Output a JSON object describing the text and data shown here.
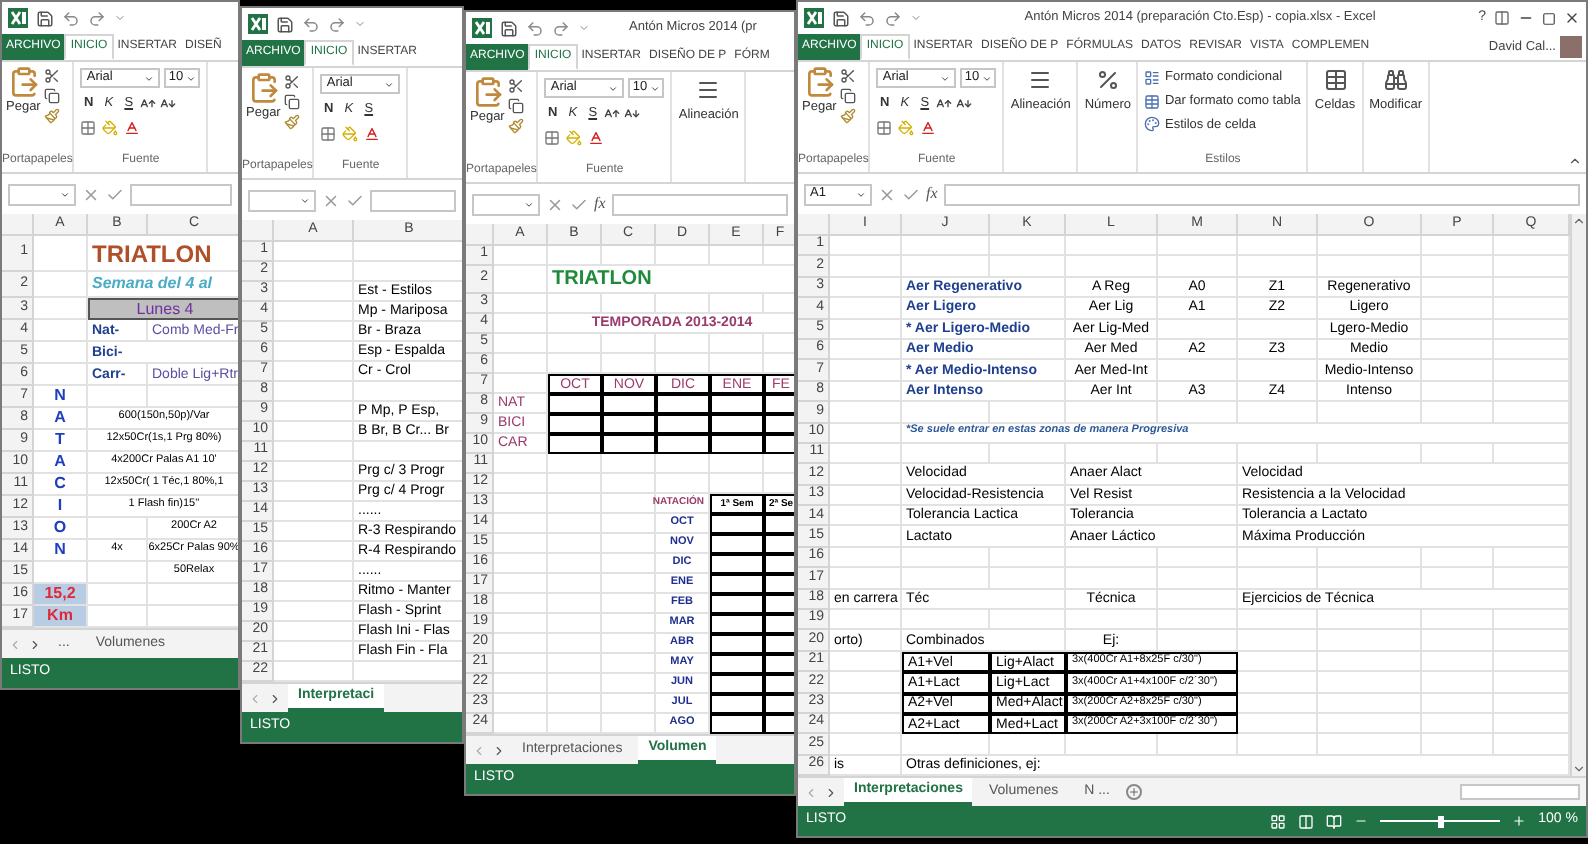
{
  "windows": [
    {
      "tabs": [
        {
          "label": "ARCHIVO",
          "kind": "file"
        },
        {
          "label": "INICIO",
          "kind": "tab",
          "selected": true
        },
        {
          "label": "INSERTAR",
          "kind": "tab",
          "selected": false
        },
        {
          "label": "DISEÑ",
          "kind": "tab",
          "selected": false
        }
      ],
      "ribbon": [
        {
          "kind": "clipboard",
          "label": "Portapapeles",
          "button": "Pegar"
        },
        {
          "kind": "font",
          "label": "Fuente",
          "font": "Arial",
          "size": "10",
          "styles": [
            "N",
            "K",
            "S"
          ]
        }
      ],
      "columns": [
        "A",
        "B",
        "C"
      ],
      "rows": [
        {
          "number": "1",
          "cells": [
            null,
            {
              "text": "TRIATLON",
              "kind": "title1"
            },
            null
          ]
        },
        {
          "number": "2",
          "cells": [
            null,
            {
              "text": "Semana del 4 al",
              "kind": "subtitle"
            },
            null
          ]
        },
        {
          "number": "3",
          "cells": [
            null,
            {
              "text": "Lunes 4",
              "kind": "day"
            },
            null
          ]
        },
        {
          "number": "4",
          "cells": [
            null,
            {
              "text": "Nat-",
              "kind": "label"
            },
            {
              "text": "Comb Med-Fr",
              "kind": "detail"
            }
          ]
        },
        {
          "number": "5",
          "cells": [
            null,
            {
              "text": "Bici-",
              "kind": "label"
            },
            null
          ]
        },
        {
          "number": "6",
          "cells": [
            null,
            {
              "text": "Carr-",
              "kind": "label"
            },
            {
              "text": "Doble Lig+Rtr",
              "kind": "detail"
            }
          ]
        },
        {
          "number": "7",
          "cells": [
            {
              "text": "N",
              "kind": "vletter"
            },
            null,
            null
          ]
        },
        {
          "number": "8",
          "cells": [
            {
              "text": "A",
              "kind": "vletter"
            },
            {
              "text": "600(150n,50p)/Var",
              "kind": "small"
            },
            null
          ]
        },
        {
          "number": "9",
          "cells": [
            {
              "text": "T",
              "kind": "vletter"
            },
            {
              "text": "12x50Cr(1s,1 Prg 80%)",
              "kind": "small"
            },
            null
          ]
        },
        {
          "number": "10",
          "cells": [
            {
              "text": "A",
              "kind": "vletter"
            },
            {
              "text": "4x200Cr Palas A1 10'",
              "kind": "small"
            },
            null
          ]
        },
        {
          "number": "11",
          "cells": [
            {
              "text": "C",
              "kind": "vletter"
            },
            {
              "text": "12x50Cr( 1 Téc,1 80%,1",
              "kind": "small"
            },
            null
          ]
        },
        {
          "number": "12",
          "cells": [
            {
              "text": "I",
              "kind": "vletter"
            },
            {
              "text": "1 Flash fin)15''",
              "kind": "small"
            },
            null
          ]
        },
        {
          "number": "13",
          "cells": [
            {
              "text": "O",
              "kind": "vletter"
            },
            null,
            {
              "text": "200Cr A2",
              "kind": "small"
            }
          ]
        },
        {
          "number": "14",
          "cells": [
            {
              "text": "N",
              "kind": "vletter"
            },
            {
              "text": "4x",
              "kind": "small"
            },
            {
              "text": "6x25Cr Palas 90%",
              "kind": "small"
            }
          ]
        },
        {
          "number": "15",
          "cells": [
            null,
            null,
            {
              "text": "50Relax",
              "kind": "small"
            }
          ]
        },
        {
          "number": "16",
          "cells": [
            {
              "text": "15,2",
              "kind": "km"
            },
            null,
            null
          ]
        },
        {
          "number": "17",
          "cells": [
            {
              "text": "Km",
              "kind": "km"
            },
            null,
            null
          ]
        }
      ],
      "sheet_tabs": [
        {
          "label": "...",
          "selected": false
        },
        {
          "label": "Volumenes",
          "selected": false
        }
      ],
      "status": {
        "text": "LISTO"
      }
    },
    {
      "tabs": [
        {
          "label": "ARCHIVO",
          "kind": "file"
        },
        {
          "label": "INICIO",
          "kind": "tab",
          "selected": true
        },
        {
          "label": "INSERTAR",
          "kind": "tab",
          "selected": false
        }
      ],
      "ribbon": [
        {
          "kind": "clipboard",
          "label": "Portapapeles",
          "button": "Pegar"
        },
        {
          "kind": "font",
          "label": "Fuente",
          "font": "Arial",
          "styles": [
            "N",
            "K",
            "S"
          ]
        }
      ],
      "columns": [
        "A",
        "B"
      ],
      "rows": [
        {
          "number": "1"
        },
        {
          "number": "2"
        },
        {
          "number": "3",
          "cells": [
            null,
            {
              "text": "Est - Estilos",
              "kind": "plain"
            }
          ]
        },
        {
          "number": "4",
          "cells": [
            null,
            {
              "text": "Mp - Mariposa",
              "kind": "plain"
            }
          ]
        },
        {
          "number": "5",
          "cells": [
            null,
            {
              "text": "Br - Braza",
              "kind": "plain"
            }
          ]
        },
        {
          "number": "6",
          "cells": [
            null,
            {
              "text": "Esp - Espalda",
              "kind": "plain"
            }
          ]
        },
        {
          "number": "7",
          "cells": [
            null,
            {
              "text": "Cr - Crol",
              "kind": "plain"
            }
          ]
        },
        {
          "number": "8"
        },
        {
          "number": "9",
          "cells": [
            null,
            {
              "text": "P Mp, P Esp,",
              "kind": "plain"
            }
          ]
        },
        {
          "number": "10",
          "cells": [
            null,
            {
              "text": "B Br, B Cr... Br",
              "kind": "plain"
            }
          ]
        },
        {
          "number": "11"
        },
        {
          "number": "12",
          "cells": [
            null,
            {
              "text": "Prg c/ 3  Progr",
              "kind": "plain"
            }
          ]
        },
        {
          "number": "13",
          "cells": [
            null,
            {
              "text": "Prg c/ 4  Progr",
              "kind": "plain"
            }
          ]
        },
        {
          "number": "14",
          "cells": [
            null,
            {
              "text": "......",
              "kind": "plain"
            }
          ]
        },
        {
          "number": "15",
          "cells": [
            null,
            {
              "text": "R-3 Respirando",
              "kind": "plain"
            }
          ]
        },
        {
          "number": "16",
          "cells": [
            null,
            {
              "text": "R-4 Respirando",
              "kind": "plain"
            }
          ]
        },
        {
          "number": "17",
          "cells": [
            null,
            {
              "text": "......",
              "kind": "plain"
            }
          ]
        },
        {
          "number": "18",
          "cells": [
            null,
            {
              "text": "Ritmo - Manter",
              "kind": "plain"
            }
          ]
        },
        {
          "number": "19",
          "cells": [
            null,
            {
              "text": "Flash - Sprint",
              "kind": "plain"
            }
          ]
        },
        {
          "number": "20",
          "cells": [
            null,
            {
              "text": "Flash Ini - Flas",
              "kind": "plain"
            }
          ]
        },
        {
          "number": "21",
          "cells": [
            null,
            {
              "text": "Flash Fin - Fla",
              "kind": "plain"
            }
          ]
        },
        {
          "number": "22"
        }
      ],
      "sheet_tabs": [
        {
          "label": "Interpretaci",
          "selected": true
        }
      ],
      "status": {
        "text": "LISTO"
      }
    },
    {
      "title": "Antón Micros 2014 (pr",
      "tabs": [
        {
          "label": "ARCHIVO",
          "kind": "file"
        },
        {
          "label": "INICIO",
          "kind": "tab",
          "selected": true
        },
        {
          "label": "INSERTAR",
          "kind": "tab",
          "selected": false
        },
        {
          "label": "DISEÑO DE P",
          "kind": "tab",
          "selected": false
        },
        {
          "label": "FÓRM",
          "kind": "tab",
          "selected": false
        }
      ],
      "ribbon": [
        {
          "kind": "clipboard",
          "label": "Portapapeles",
          "button": "Pegar"
        },
        {
          "kind": "font",
          "label": "Fuente",
          "font": "Arial",
          "size": "10",
          "styles": [
            "N",
            "K",
            "S"
          ]
        },
        {
          "kind": "alignment",
          "button": "Alineación"
        }
      ],
      "formula_bar": {
        "fx": "fx"
      },
      "columns": [
        "A",
        "B",
        "C",
        "D",
        "E",
        "F"
      ],
      "rows": [
        {
          "number": "1"
        },
        {
          "number": "2",
          "cells": [
            null,
            {
              "text": "TRIATLON",
              "kind": "title3"
            },
            null,
            null,
            null,
            null
          ]
        },
        {
          "number": "3"
        },
        {
          "number": "4",
          "cells": [
            null,
            {
              "text": "TEMPORADA 2013-2014",
              "kind": "season"
            },
            null,
            null,
            null,
            null
          ]
        },
        {
          "number": "5"
        },
        {
          "number": "6"
        },
        {
          "number": "7",
          "cells": [
            null,
            {
              "text": "OCT",
              "kind": "month_head"
            },
            {
              "text": "NOV",
              "kind": "month_head"
            },
            {
              "text": "DIC",
              "kind": "month_head"
            },
            {
              "text": "ENE",
              "kind": "month_head"
            },
            {
              "text": "FE",
              "kind": "month_head"
            }
          ]
        },
        {
          "number": "8",
          "cells": [
            {
              "text": "NAT",
              "kind": "rowlabel"
            },
            {
              "kind": "box"
            },
            {
              "kind": "box"
            },
            {
              "kind": "box"
            },
            {
              "kind": "box"
            },
            {
              "kind": "box"
            }
          ]
        },
        {
          "number": "9",
          "cells": [
            {
              "text": "BICI",
              "kind": "rowlabel"
            },
            {
              "kind": "box"
            },
            {
              "kind": "box"
            },
            {
              "kind": "box"
            },
            {
              "kind": "box"
            },
            {
              "kind": "box"
            }
          ]
        },
        {
          "number": "10",
          "cells": [
            {
              "text": "CAR",
              "kind": "rowlabel"
            },
            {
              "kind": "box"
            },
            {
              "kind": "box"
            },
            {
              "kind": "box"
            },
            {
              "kind": "box"
            },
            {
              "kind": "box"
            }
          ]
        },
        {
          "number": "11"
        },
        {
          "number": "12"
        },
        {
          "number": "13",
          "cells": [
            null,
            null,
            null,
            {
              "text": "NATACIÓN",
              "kind": "natacion"
            },
            {
              "text": "1ª Sem",
              "kind": "semhead"
            },
            {
              "text": "2ª Se",
              "kind": "semhead"
            }
          ]
        },
        {
          "number": "14",
          "cells": [
            null,
            null,
            null,
            {
              "text": "OCT",
              "kind": "month"
            },
            {
              "kind": "box"
            },
            {
              "kind": "box"
            }
          ]
        },
        {
          "number": "15",
          "cells": [
            null,
            null,
            null,
            {
              "text": "NOV",
              "kind": "month"
            },
            {
              "kind": "box"
            },
            {
              "kind": "box"
            }
          ]
        },
        {
          "number": "16",
          "cells": [
            null,
            null,
            null,
            {
              "text": "DIC",
              "kind": "month"
            },
            {
              "kind": "box"
            },
            {
              "kind": "box"
            }
          ]
        },
        {
          "number": "17",
          "cells": [
            null,
            null,
            null,
            {
              "text": "ENE",
              "kind": "month"
            },
            {
              "kind": "box"
            },
            {
              "kind": "box"
            }
          ]
        },
        {
          "number": "18",
          "cells": [
            null,
            null,
            null,
            {
              "text": "FEB",
              "kind": "month"
            },
            {
              "kind": "box"
            },
            {
              "kind": "box"
            }
          ]
        },
        {
          "number": "19",
          "cells": [
            null,
            null,
            null,
            {
              "text": "MAR",
              "kind": "month"
            },
            {
              "kind": "box"
            },
            {
              "kind": "box"
            }
          ]
        },
        {
          "number": "20",
          "cells": [
            null,
            null,
            null,
            {
              "text": "ABR",
              "kind": "month"
            },
            {
              "kind": "box"
            },
            {
              "kind": "box"
            }
          ]
        },
        {
          "number": "21",
          "cells": [
            null,
            null,
            null,
            {
              "text": "MAY",
              "kind": "month"
            },
            {
              "kind": "box"
            },
            {
              "kind": "box"
            }
          ]
        },
        {
          "number": "22",
          "cells": [
            null,
            null,
            null,
            {
              "text": "JUN",
              "kind": "month"
            },
            {
              "kind": "box"
            },
            {
              "kind": "box"
            }
          ]
        },
        {
          "number": "23",
          "cells": [
            null,
            null,
            null,
            {
              "text": "JUL",
              "kind": "month"
            },
            {
              "kind": "box"
            },
            {
              "kind": "box"
            }
          ]
        },
        {
          "number": "24",
          "cells": [
            null,
            null,
            null,
            {
              "text": "AGO",
              "kind": "month"
            },
            {
              "kind": "box"
            },
            {
              "kind": "box"
            }
          ]
        }
      ],
      "sheet_tabs": [
        {
          "label": "Interpretaciones",
          "selected": false
        },
        {
          "label": "Volumen",
          "selected": true
        }
      ],
      "status": {
        "text": "LISTO"
      }
    },
    {
      "title": "Antón Micros 2014 (preparación Cto.Esp) - copia.xlsx - Excel",
      "help": "?",
      "tabs": [
        {
          "label": "ARCHIVO",
          "kind": "file"
        },
        {
          "label": "INICIO",
          "kind": "tab",
          "selected": true
        },
        {
          "label": "INSERTAR",
          "kind": "tab",
          "selected": false
        },
        {
          "label": "DISEÑO DE P",
          "kind": "tab",
          "selected": false
        },
        {
          "label": "FÓRMULAS",
          "kind": "tab",
          "selected": false
        },
        {
          "label": "DATOS",
          "kind": "tab",
          "selected": false
        },
        {
          "label": "REVISAR",
          "kind": "tab",
          "selected": false
        },
        {
          "label": "VISTA",
          "kind": "tab",
          "selected": false
        },
        {
          "label": "COMPLEMEN",
          "kind": "tab",
          "selected": false
        }
      ],
      "account": "David Cal...",
      "ribbon": [
        {
          "kind": "clipboard",
          "label": "Portapapeles",
          "button": "Pegar"
        },
        {
          "kind": "font",
          "label": "Fuente",
          "font": "Arial",
          "size": "10",
          "styles": [
            "N",
            "K",
            "S"
          ]
        },
        {
          "kind": "alignment",
          "button": "Alineación"
        },
        {
          "kind": "number",
          "button": "Número"
        },
        {
          "kind": "styles",
          "label": "Estilos",
          "items": [
            "Formato condicional",
            "Dar formato como tabla",
            "Estilos de celda"
          ]
        },
        {
          "kind": "cells",
          "button": "Celdas"
        },
        {
          "kind": "editing",
          "button": "Modificar"
        }
      ],
      "formula_bar": {
        "name_box": "A1",
        "fx": "fx"
      },
      "columns": [
        "I",
        "J",
        "K",
        "L",
        "M",
        "N",
        "O",
        "P",
        "Q"
      ],
      "rows": [
        {
          "number": "1"
        },
        {
          "number": "2"
        },
        {
          "number": "3",
          "cells": [
            null,
            {
              "text": "Aer Regenerativo",
              "kind": "label"
            },
            null,
            {
              "text": "A Reg",
              "kind": "center"
            },
            {
              "text": "A0",
              "kind": "center"
            },
            {
              "text": "Z1",
              "kind": "center"
            },
            {
              "text": "Regenerativo",
              "kind": "center"
            },
            null,
            null
          ]
        },
        {
          "number": "4",
          "cells": [
            null,
            {
              "text": "Aer Ligero",
              "kind": "label"
            },
            null,
            {
              "text": "Aer Lig",
              "kind": "center"
            },
            {
              "text": "A1",
              "kind": "center"
            },
            {
              "text": "Z2",
              "kind": "center"
            },
            {
              "text": "Ligero",
              "kind": "center"
            },
            null,
            null
          ]
        },
        {
          "number": "5",
          "cells": [
            null,
            {
              "text": "* Aer Ligero-Medio",
              "kind": "label"
            },
            null,
            {
              "text": "Aer Lig-Med",
              "kind": "center"
            },
            null,
            null,
            {
              "text": "Lgero-Medio",
              "kind": "center"
            },
            null,
            null
          ]
        },
        {
          "number": "6",
          "cells": [
            null,
            {
              "text": "Aer Medio",
              "kind": "label"
            },
            null,
            {
              "text": "Aer Med",
              "kind": "center"
            },
            {
              "text": "A2",
              "kind": "center"
            },
            {
              "text": "Z3",
              "kind": "center"
            },
            {
              "text": "Medio",
              "kind": "center"
            },
            null,
            null
          ]
        },
        {
          "number": "7",
          "cells": [
            null,
            {
              "text": "* Aer Medio-Intenso",
              "kind": "label"
            },
            null,
            {
              "text": "Aer Med-Int",
              "kind": "center"
            },
            null,
            null,
            {
              "text": "Medio-Intenso",
              "kind": "center"
            },
            null,
            null
          ]
        },
        {
          "number": "8",
          "cells": [
            null,
            {
              "text": "Aer Intenso",
              "kind": "label"
            },
            null,
            {
              "text": "Aer Int",
              "kind": "center"
            },
            {
              "text": "A3",
              "kind": "center"
            },
            {
              "text": "Z4",
              "kind": "center"
            },
            {
              "text": "Intenso",
              "kind": "center"
            },
            null,
            null
          ]
        },
        {
          "number": "9"
        },
        {
          "number": "10",
          "cells": [
            null,
            {
              "text": "*Se suele entrar en estas zonas de manera Progresiva",
              "kind": "note"
            },
            null,
            null,
            null,
            null,
            null,
            null,
            null
          ]
        },
        {
          "number": "11"
        },
        {
          "number": "12",
          "cells": [
            null,
            {
              "text": "Velocidad",
              "kind": "plain"
            },
            null,
            {
              "text": "Anaer Alact",
              "kind": "plain"
            },
            null,
            {
              "text": "Velocidad",
              "kind": "plain"
            },
            null,
            null,
            null
          ]
        },
        {
          "number": "13",
          "cells": [
            null,
            {
              "text": "Velocidad-Resistencia",
              "kind": "plain"
            },
            null,
            {
              "text": "Vel Resist",
              "kind": "plain"
            },
            null,
            {
              "text": "Resistencia a la Velocidad",
              "kind": "plain"
            },
            null,
            null,
            null
          ]
        },
        {
          "number": "14",
          "cells": [
            null,
            {
              "text": "Tolerancia Lactica",
              "kind": "plain"
            },
            null,
            {
              "text": "Tolerancia",
              "kind": "plain"
            },
            null,
            {
              "text": "Tolerancia a Lactato",
              "kind": "plain"
            },
            null,
            null,
            null
          ]
        },
        {
          "number": "15",
          "cells": [
            null,
            {
              "text": "Lactato",
              "kind": "plain"
            },
            null,
            {
              "text": "Anaer Láctico",
              "kind": "plain"
            },
            null,
            {
              "text": "Máxima Producción",
              "kind": "plain"
            },
            null,
            null,
            null
          ]
        },
        {
          "number": "16"
        },
        {
          "number": "17"
        },
        {
          "number": "18",
          "cells": [
            {
              "text": "en carrera",
              "kind": "plain"
            },
            {
              "text": "Téc",
              "kind": "plain"
            },
            null,
            {
              "text": "Técnica",
              "kind": "center"
            },
            null,
            {
              "text": "Ejercicios de Técnica",
              "kind": "plain"
            },
            null,
            null,
            null
          ]
        },
        {
          "number": "19"
        },
        {
          "number": "20",
          "cells": [
            {
              "text": "orto)",
              "kind": "plain"
            },
            {
              "text": "Combinados",
              "kind": "plain"
            },
            null,
            {
              "text": "Ej:",
              "kind": "center"
            },
            null,
            null,
            null,
            null,
            null
          ]
        },
        {
          "number": "21",
          "cells": [
            null,
            {
              "text": "A1+Vel",
              "kind": "boxtext"
            },
            {
              "text": "Lig+Alact",
              "kind": "boxtext"
            },
            {
              "text": "3x(400Cr A1+8x25F c/30\")",
              "kind": "boxsmall",
              "wide": true
            },
            null,
            null,
            null,
            null,
            null
          ]
        },
        {
          "number": "22",
          "cells": [
            null,
            {
              "text": "A1+Lact",
              "kind": "boxtext"
            },
            {
              "text": "Lig+Lact",
              "kind": "boxtext"
            },
            {
              "text": "3x(400Cr A1+4x100F c/2´30\")",
              "kind": "boxsmall",
              "wide": true
            },
            null,
            null,
            null,
            null,
            null
          ]
        },
        {
          "number": "23",
          "cells": [
            null,
            {
              "text": "A2+Vel",
              "kind": "boxtext"
            },
            {
              "text": "Med+Alact",
              "kind": "boxtext"
            },
            {
              "text": "3x(200Cr A2+8x25F c/30\")",
              "kind": "boxsmall",
              "wide": true
            },
            null,
            null,
            null,
            null,
            null
          ]
        },
        {
          "number": "24",
          "cells": [
            null,
            {
              "text": "A2+Lact",
              "kind": "boxtext"
            },
            {
              "text": "Med+Lact",
              "kind": "boxtext"
            },
            {
              "text": "3x(200Cr A2+3x100F c/2´30\")",
              "kind": "boxsmall",
              "wide": true
            },
            null,
            null,
            null,
            null,
            null
          ]
        },
        {
          "number": "25"
        },
        {
          "number": "26",
          "cells": [
            {
              "text": "is",
              "kind": "plain"
            },
            {
              "text": "Otras definiciones, ej:",
              "kind": "plain"
            },
            null,
            null,
            null,
            null,
            null,
            null,
            null
          ]
        }
      ],
      "sheet_tabs": [
        {
          "label": "Interpretaciones",
          "selected": true
        },
        {
          "label": "Volumenes",
          "selected": false
        },
        {
          "label": "N ...",
          "selected": false
        }
      ],
      "status": {
        "text": "LISTO",
        "zoom": "100 %",
        "level": 0.5
      }
    }
  ]
}
